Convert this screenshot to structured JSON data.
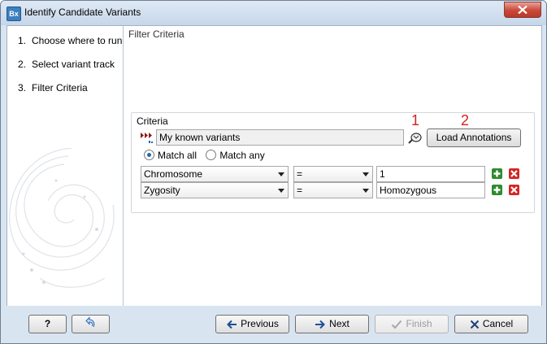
{
  "window": {
    "title": "Identify Candidate Variants",
    "app_icon_text": "Bx"
  },
  "steps": [
    {
      "num": "1.",
      "label": "Choose where to run"
    },
    {
      "num": "2.",
      "label": "Select variant track"
    },
    {
      "num": "3.",
      "label": "Filter Criteria"
    }
  ],
  "panel": {
    "section_title": "Filter Criteria",
    "group_title": "Criteria",
    "track_value": "My known variants",
    "marker_1": "1",
    "marker_2": "2",
    "load_button": "Load Annotations",
    "match_all": "Match all",
    "match_any": "Match any",
    "match_selected": "all"
  },
  "rows": [
    {
      "field": "Chromosome",
      "operator": "=",
      "value": "1"
    },
    {
      "field": "Zygosity",
      "operator": "=",
      "value": "Homozygous"
    }
  ],
  "footer": {
    "help": "?",
    "previous": "Previous",
    "next": "Next",
    "finish": "Finish",
    "cancel": "Cancel"
  },
  "colors": {
    "marker": "#d42020",
    "add": "#2e8b2e",
    "remove": "#d42525",
    "accent": "#2566b6"
  }
}
